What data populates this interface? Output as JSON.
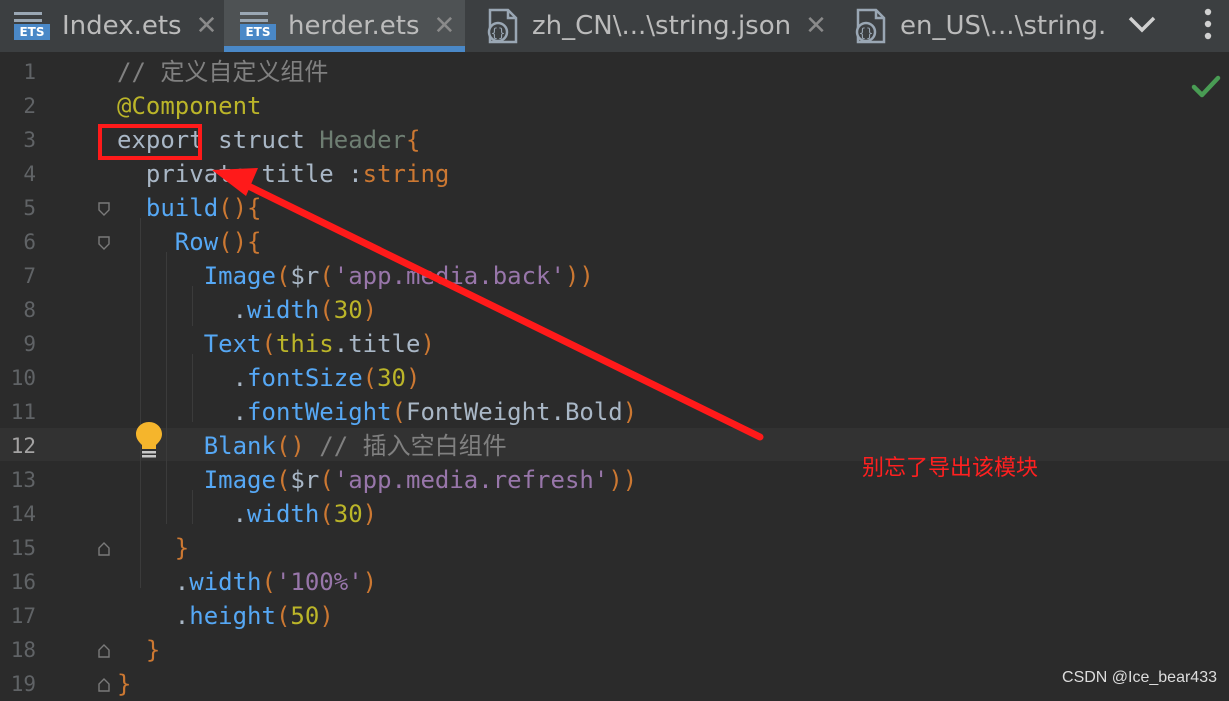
{
  "tabs": [
    {
      "label": "Index.ets",
      "icon": "ets-file-icon",
      "active": false
    },
    {
      "label": "herder.ets",
      "icon": "ets-file-icon",
      "active": true
    },
    {
      "label": "zh_CN\\...\\string.json",
      "icon": "json-file-icon",
      "active": false
    },
    {
      "label": "en_US\\...\\string.j",
      "icon": "json-file-icon",
      "active": false
    }
  ],
  "icons": {
    "ets_badge": "ETS",
    "close": "✕",
    "overflow": "chevron-down-icon",
    "more": "vertical-ellipsis-icon",
    "status": "check-icon",
    "intention": "lightbulb-icon"
  },
  "code_lines": [
    {
      "n": "1",
      "tokens": [
        [
          "c-comment",
          "// 定义自定义组件"
        ]
      ]
    },
    {
      "n": "2",
      "tokens": [
        [
          "c-annot",
          "@Component"
        ]
      ]
    },
    {
      "n": "3",
      "tokens": [
        [
          "c-plain",
          "export"
        ],
        [
          "c-plain",
          " "
        ],
        [
          "c-plain",
          "struct"
        ],
        [
          "c-plain",
          " "
        ],
        [
          "c-header",
          "Header"
        ],
        [
          "c-brace",
          "{"
        ]
      ]
    },
    {
      "n": "4",
      "tokens": [
        [
          "c-plain",
          "  private title :"
        ],
        [
          "c-kw",
          "string"
        ]
      ]
    },
    {
      "n": "5",
      "tokens": [
        [
          "c-fn",
          "  build"
        ],
        [
          "c-kw",
          "(){"
        ]
      ]
    },
    {
      "n": "6",
      "tokens": [
        [
          "c-fn",
          "    Row"
        ],
        [
          "c-kw",
          "(){"
        ]
      ]
    },
    {
      "n": "7",
      "tokens": [
        [
          "c-fn",
          "      Image"
        ],
        [
          "c-kw",
          "("
        ],
        [
          "c-plain",
          "$r"
        ],
        [
          "c-kw",
          "("
        ],
        [
          "c-str2",
          "'app.media.back'"
        ],
        [
          "c-kw",
          "))"
        ]
      ]
    },
    {
      "n": "8",
      "tokens": [
        [
          "c-plain",
          "        ."
        ],
        [
          "c-fn",
          "width"
        ],
        [
          "c-kw",
          "("
        ],
        [
          "c-annot",
          "30"
        ],
        [
          "c-kw",
          ")"
        ]
      ]
    },
    {
      "n": "9",
      "tokens": [
        [
          "c-fn",
          "      Text"
        ],
        [
          "c-kw",
          "("
        ],
        [
          "c-annot",
          "this"
        ],
        [
          "c-plain",
          ".title"
        ],
        [
          "c-kw",
          ")"
        ]
      ]
    },
    {
      "n": "10",
      "tokens": [
        [
          "c-plain",
          "        ."
        ],
        [
          "c-fn",
          "fontSize"
        ],
        [
          "c-kw",
          "("
        ],
        [
          "c-annot",
          "30"
        ],
        [
          "c-kw",
          ")"
        ]
      ]
    },
    {
      "n": "11",
      "tokens": [
        [
          "c-plain",
          "        ."
        ],
        [
          "c-fn",
          "fontWeight"
        ],
        [
          "c-kw",
          "("
        ],
        [
          "c-plain",
          "FontWeight.Bold"
        ],
        [
          "c-kw",
          ")"
        ]
      ]
    },
    {
      "n": "12",
      "tokens": [
        [
          "c-fn",
          "      Blank"
        ],
        [
          "c-kw",
          "()"
        ],
        [
          "c-comment",
          " // 插入空白组件"
        ]
      ]
    },
    {
      "n": "13",
      "tokens": [
        [
          "c-fn",
          "      Image"
        ],
        [
          "c-kw",
          "("
        ],
        [
          "c-plain",
          "$r"
        ],
        [
          "c-kw",
          "("
        ],
        [
          "c-str2",
          "'app.media.refresh'"
        ],
        [
          "c-kw",
          "))"
        ]
      ]
    },
    {
      "n": "14",
      "tokens": [
        [
          "c-plain",
          "        ."
        ],
        [
          "c-fn",
          "width"
        ],
        [
          "c-kw",
          "("
        ],
        [
          "c-annot",
          "30"
        ],
        [
          "c-kw",
          ")"
        ]
      ]
    },
    {
      "n": "15",
      "tokens": [
        [
          "c-kw",
          "    }"
        ]
      ]
    },
    {
      "n": "16",
      "tokens": [
        [
          "c-plain",
          "    ."
        ],
        [
          "c-fn",
          "width"
        ],
        [
          "c-kw",
          "("
        ],
        [
          "c-str2",
          "'100%'"
        ],
        [
          "c-kw",
          ")"
        ]
      ]
    },
    {
      "n": "17",
      "tokens": [
        [
          "c-plain",
          "    ."
        ],
        [
          "c-fn",
          "height"
        ],
        [
          "c-kw",
          "("
        ],
        [
          "c-annot",
          "50"
        ],
        [
          "c-kw",
          ")"
        ]
      ]
    },
    {
      "n": "18",
      "tokens": [
        [
          "c-kw",
          "  }"
        ]
      ]
    },
    {
      "n": "19",
      "tokens": [
        [
          "c-kw",
          "}"
        ]
      ]
    }
  ],
  "current_line": "12",
  "annotation": {
    "note": "别忘了导出该模块",
    "highlight_color": "#ff1a1a"
  },
  "watermark": "CSDN @Ice_bear433"
}
